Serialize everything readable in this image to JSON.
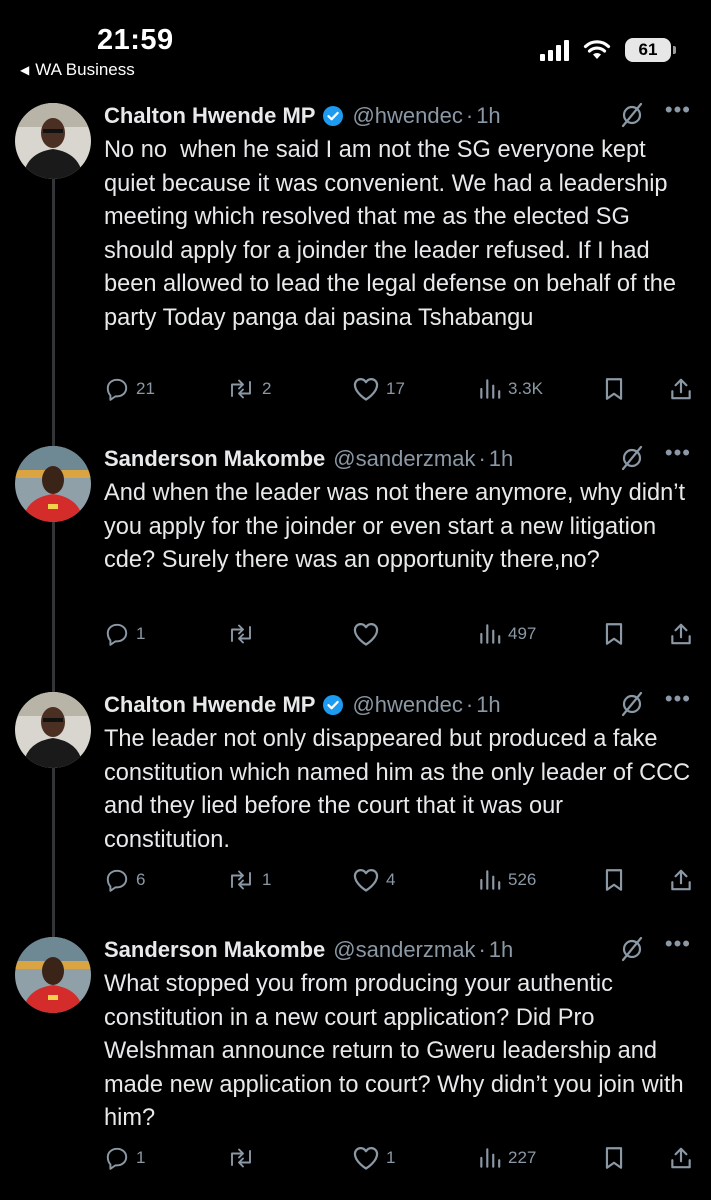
{
  "status_bar": {
    "time": "21:59",
    "back_label": "WA Business",
    "battery": "61"
  },
  "tweets": [
    {
      "name": "Chalton Hwende MP",
      "verified": true,
      "handle": "@hwendec",
      "time": "1h",
      "text": "No no  when he said I am not the SG everyone kept quiet because it was convenient. We had a leadership meeting which resolved that me as the elected SG should apply for a joinder the leader refused. If I had been allowed to lead the legal defense on behalf of the party Today panga dai pasina Tshabangu",
      "replies": "21",
      "reposts": "2",
      "likes": "17",
      "views": "3.3K"
    },
    {
      "name": "Sanderson Makombe",
      "verified": false,
      "handle": "@sanderzmak",
      "time": "1h",
      "text": "And when the leader was not there anymore, why didn’t you apply for the joinder or even start a new litigation cde? Surely there was an opportunity there,no?",
      "replies": "1",
      "reposts": "",
      "likes": "",
      "views": "497"
    },
    {
      "name": "Chalton Hwende MP",
      "verified": true,
      "handle": "@hwendec",
      "time": "1h",
      "text": "The leader not only disappeared but produced a fake constitution which named him as the only leader of CCC and they lied before the court that it was our constitution.",
      "replies": "6",
      "reposts": "1",
      "likes": "4",
      "views": "526"
    },
    {
      "name": "Sanderson Makombe",
      "verified": false,
      "handle": "@sanderzmak",
      "time": "1h",
      "text": "What stopped you from producing your authentic constitution in a new court application? Did Pro Welshman announce return to Gweru leadership and made new application to court? Why didn’t you join with him?",
      "replies": "1",
      "reposts": "",
      "likes": "1",
      "views": "227"
    }
  ],
  "colors": {
    "background": "#000000",
    "text": "#e7e9ea",
    "muted": "#8b98a5",
    "verified": "#1d9bf0",
    "thread_line": "#333639"
  },
  "icons": [
    "reply-icon",
    "repost-icon",
    "like-icon",
    "views-icon",
    "bookmark-icon",
    "share-icon",
    "grok-icon",
    "more-icon",
    "verified-icon"
  ]
}
